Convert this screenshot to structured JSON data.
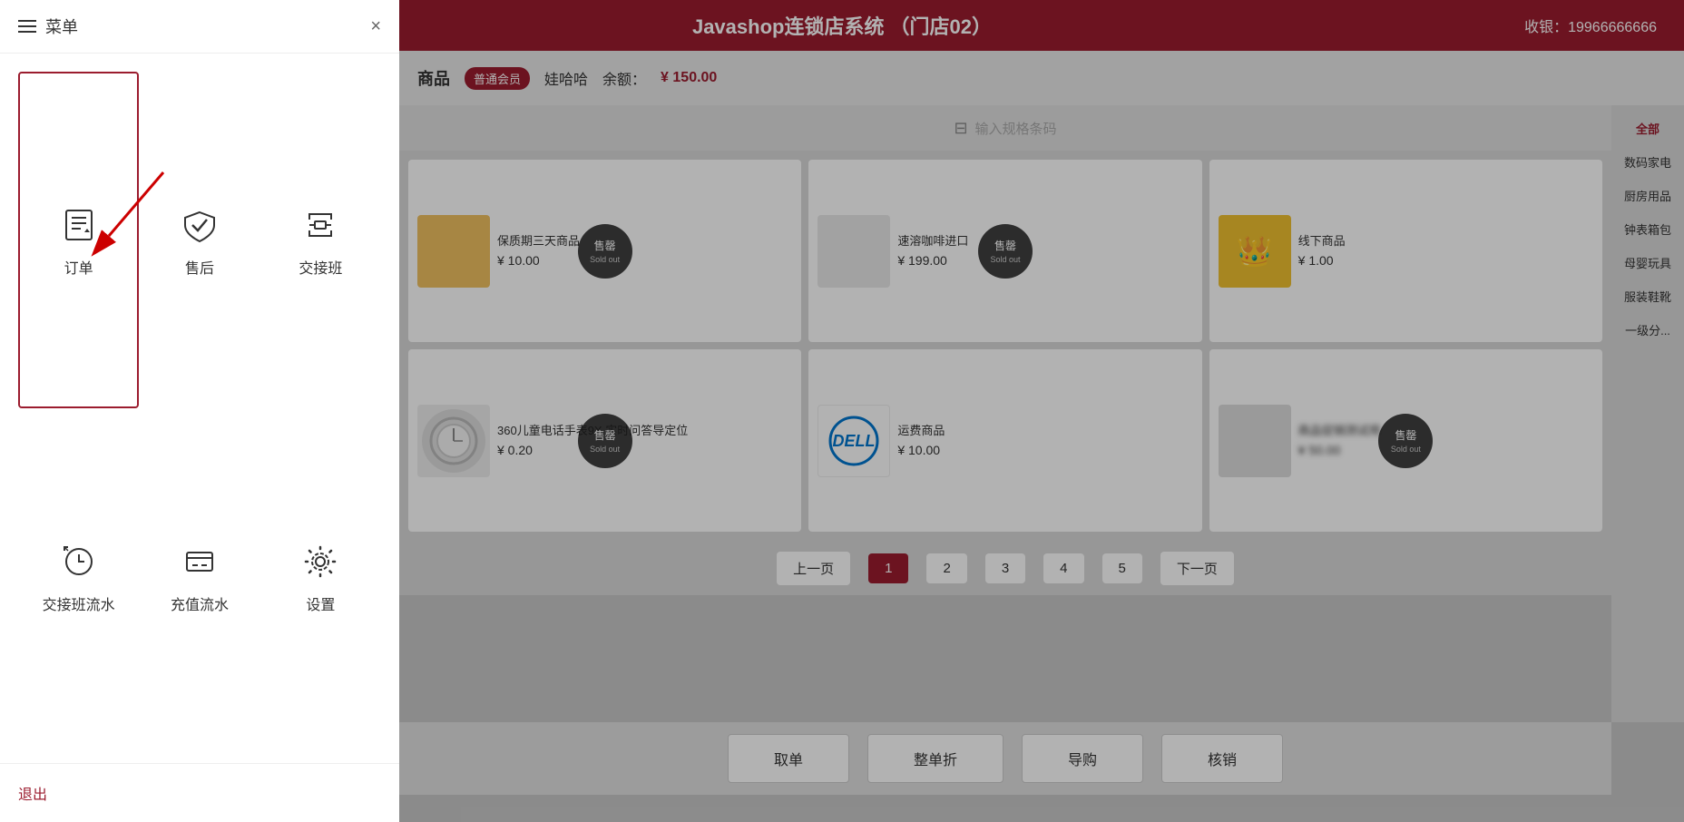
{
  "header": {
    "title": "Javashop连锁店系统  （门店02）",
    "cashier_label": "收银：",
    "cashier_value": "19966666666"
  },
  "subheader": {
    "goods_label": "商品",
    "member_badge": "普通会员",
    "member_name": "娃哈哈",
    "balance_prefix": "余额：",
    "balance": "¥ 150.00"
  },
  "search": {
    "placeholder": "输入规格条码"
  },
  "categories": [
    {
      "label": "全部",
      "active": true
    },
    {
      "label": "数码家电"
    },
    {
      "label": "厨房用品"
    },
    {
      "label": "钟表箱包"
    },
    {
      "label": "母婴玩具"
    },
    {
      "label": "服装鞋靴"
    },
    {
      "label": "一级分..."
    }
  ],
  "products": [
    {
      "name": "保质期三天商品",
      "price": "¥ 10.00",
      "sold_out": true,
      "img_type": "yellow"
    },
    {
      "name": "速溶咖啡进口",
      "price": "¥ 199.00",
      "sold_out": true,
      "img_type": "light"
    },
    {
      "name": "线下商品",
      "price": "¥ 1.00",
      "sold_out": false,
      "img_type": "crown"
    },
    {
      "name": "360儿童电话手表9X 实时问答导定位",
      "price": "¥ 0.20",
      "sold_out": true,
      "img_type": "watch"
    },
    {
      "name": "运费商品",
      "price": "¥ 10.00",
      "sold_out": false,
      "img_type": "dell"
    },
    {
      "name": "商品促销测试用",
      "price": "¥ 50.00",
      "sold_out": true,
      "img_type": "light",
      "blurred": true
    }
  ],
  "pagination": {
    "prev": "上一页",
    "next": "下一页",
    "pages": [
      "1",
      "2",
      "3",
      "4",
      "5"
    ],
    "active": 0
  },
  "bottom_actions": [
    {
      "label": "取单"
    },
    {
      "label": "整单折"
    },
    {
      "label": "导购"
    },
    {
      "label": "核销"
    }
  ],
  "menu": {
    "title": "菜单",
    "close_icon": "×",
    "items": [
      {
        "label": "订单",
        "icon": "order",
        "selected": true
      },
      {
        "label": "售后",
        "icon": "after-sale"
      },
      {
        "label": "交接班",
        "icon": "shift"
      },
      {
        "label": "交接班流水",
        "icon": "shift-log"
      },
      {
        "label": "充值流水",
        "icon": "recharge-log"
      },
      {
        "label": "设置",
        "icon": "settings"
      }
    ],
    "logout_label": "退出"
  }
}
